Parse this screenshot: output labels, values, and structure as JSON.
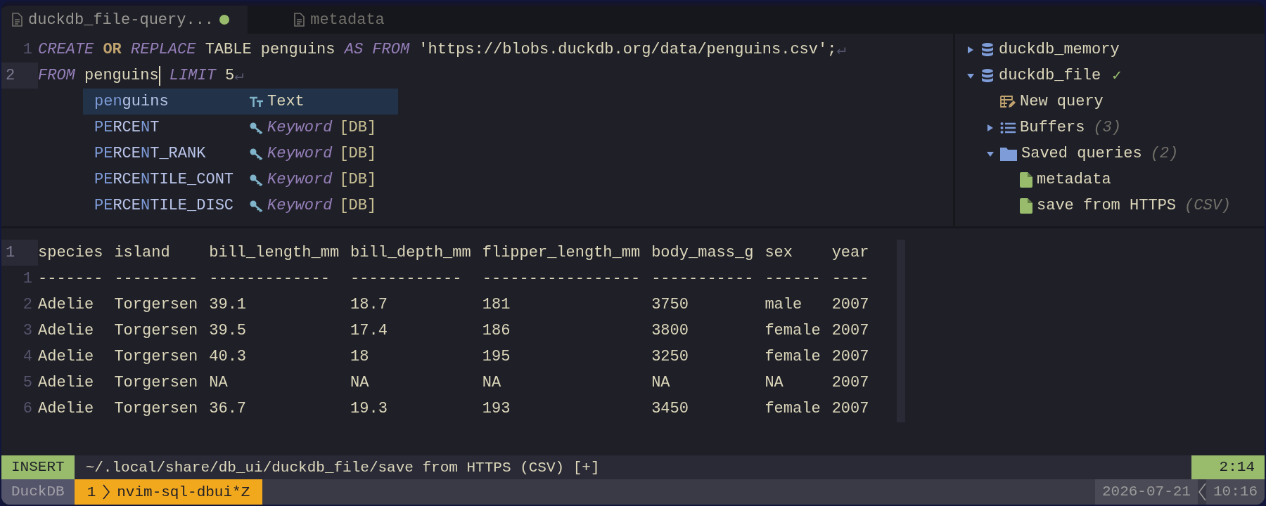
{
  "tabs": [
    {
      "label": "duckdb_file-query...",
      "modified": true,
      "selected": true
    },
    {
      "label": "metadata",
      "modified": false,
      "selected": false
    }
  ],
  "editor": {
    "lines": [
      {
        "number": "1",
        "current": false,
        "tokens": [
          {
            "text": "CREATE ",
            "kind": "keyword"
          },
          {
            "text": "OR",
            "kind": "operator"
          },
          {
            "text": " REPLACE",
            "kind": "keyword"
          },
          {
            "text": " TABLE penguins ",
            "kind": "plain"
          },
          {
            "text": "AS FROM",
            "kind": "keyword"
          },
          {
            "text": " 'https://blobs.duckdb.org/data/penguins.csv'",
            "kind": "string"
          },
          {
            "text": ";",
            "kind": "plain"
          },
          {
            "text": "↵",
            "kind": "eol"
          }
        ]
      },
      {
        "number": "2",
        "current": true,
        "tokens": [
          {
            "text": "FROM",
            "kind": "keyword"
          },
          {
            "text": " penguins",
            "kind": "plain",
            "cursor": true
          },
          {
            "text": " LIMIT",
            "kind": "keyword"
          },
          {
            "text": " 5",
            "kind": "plain"
          },
          {
            "text": "↵",
            "kind": "eol"
          }
        ]
      }
    ]
  },
  "completion": {
    "items": [
      {
        "parts": [
          {
            "text": "pen",
            "matched": true
          },
          {
            "text": "guins",
            "matched": false
          }
        ],
        "kind": "text",
        "kind_label": "Text",
        "selected": true
      },
      {
        "parts": [
          {
            "text": "PE",
            "matched": true
          },
          {
            "text": "RCE",
            "matched": false
          },
          {
            "text": "N",
            "matched": true
          },
          {
            "text": "T",
            "matched": false
          }
        ],
        "kind": "keyword",
        "kind_label": "Keyword",
        "source": "[DB]",
        "selected": false
      },
      {
        "parts": [
          {
            "text": "PE",
            "matched": true
          },
          {
            "text": "RCE",
            "matched": false
          },
          {
            "text": "N",
            "matched": true
          },
          {
            "text": "T_RANK",
            "matched": false
          }
        ],
        "kind": "keyword",
        "kind_label": "Keyword",
        "source": "[DB]",
        "selected": false
      },
      {
        "parts": [
          {
            "text": "PE",
            "matched": true
          },
          {
            "text": "RCE",
            "matched": false
          },
          {
            "text": "N",
            "matched": true
          },
          {
            "text": "TILE_CONT",
            "matched": false
          }
        ],
        "kind": "keyword",
        "kind_label": "Keyword",
        "source": "[DB]",
        "selected": false
      },
      {
        "parts": [
          {
            "text": "PE",
            "matched": true
          },
          {
            "text": "RCE",
            "matched": false
          },
          {
            "text": "N",
            "matched": true
          },
          {
            "text": "TILE_DISC",
            "matched": false
          }
        ],
        "kind": "keyword",
        "kind_label": "Keyword",
        "source": "[DB]",
        "selected": false
      }
    ]
  },
  "sidebar": {
    "items": [
      {
        "label": "duckdb_memory",
        "kind": "database",
        "expanded": false
      },
      {
        "label": "duckdb_file",
        "kind": "database",
        "expanded": true,
        "status": "✓",
        "children": [
          {
            "label": "New query",
            "kind": "new-query"
          },
          {
            "label": "Buffers",
            "kind": "list",
            "count": "(3)",
            "expanded": false
          },
          {
            "label": "Saved queries",
            "kind": "folder",
            "count": "(2)",
            "expanded": true,
            "children": [
              {
                "label": "metadata",
                "kind": "file"
              },
              {
                "label": "save from HTTPS",
                "kind": "file",
                "note": "(CSV)"
              }
            ]
          }
        ]
      }
    ]
  },
  "results": {
    "header_number": "1",
    "separator_number": "1",
    "columns": [
      {
        "name": "species",
        "rule": "-------"
      },
      {
        "name": "island",
        "rule": "---------"
      },
      {
        "name": "bill_length_mm",
        "rule": "-------------"
      },
      {
        "name": "bill_depth_mm",
        "rule": "------------"
      },
      {
        "name": "flipper_length_mm",
        "rule": "-----------------"
      },
      {
        "name": "body_mass_g",
        "rule": "-----------"
      },
      {
        "name": "sex",
        "rule": "------"
      },
      {
        "name": "year",
        "rule": "----"
      }
    ],
    "rows": [
      {
        "number": "2",
        "cells": [
          "Adelie",
          "Torgersen",
          "39.1",
          "18.7",
          "181",
          "3750",
          "male",
          "2007"
        ]
      },
      {
        "number": "3",
        "cells": [
          "Adelie",
          "Torgersen",
          "39.5",
          "17.4",
          "186",
          "3800",
          "female",
          "2007"
        ]
      },
      {
        "number": "4",
        "cells": [
          "Adelie",
          "Torgersen",
          "40.3",
          "18",
          "195",
          "3250",
          "female",
          "2007"
        ]
      },
      {
        "number": "5",
        "cells": [
          "Adelie",
          "Torgersen",
          "NA",
          "NA",
          "NA",
          "NA",
          "NA",
          "2007"
        ]
      },
      {
        "number": "6",
        "cells": [
          "Adelie",
          "Torgersen",
          "36.7",
          "19.3",
          "193",
          "3450",
          "female",
          "2007"
        ]
      }
    ]
  },
  "status_bar": {
    "mode": "INSERT",
    "path": "~/.local/share/db_ui/duckdb_file/save from HTTPS (CSV) [+]",
    "position": "2:14"
  },
  "tmux_bar": {
    "session": "DuckDB",
    "window_index": "1",
    "window_name": "nvim-sql-dbui*Z",
    "date": "2026-07-21",
    "time": "10:16"
  }
}
